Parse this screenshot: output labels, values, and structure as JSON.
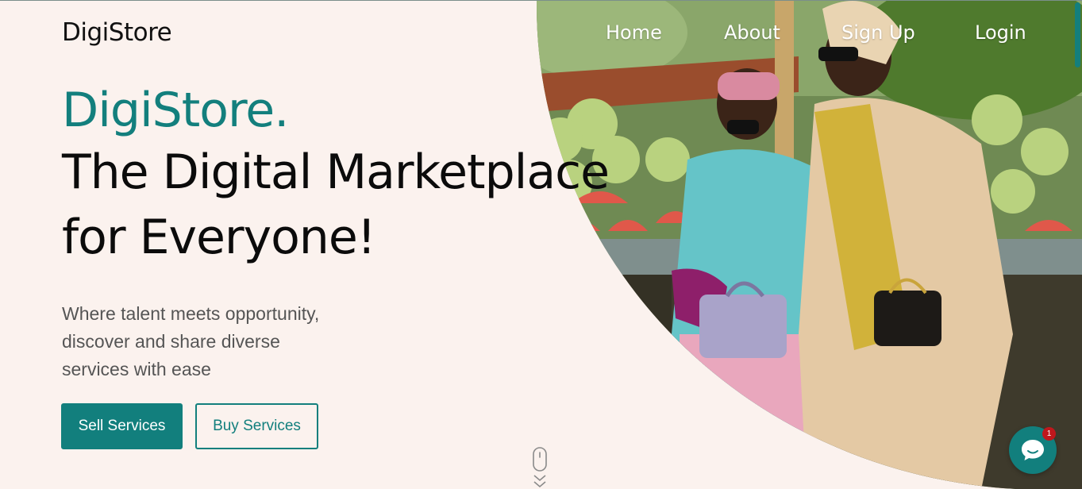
{
  "header": {
    "logo": "DigiStore",
    "nav": [
      {
        "label": "Home"
      },
      {
        "label": "About"
      },
      {
        "label": "Sign Up"
      },
      {
        "label": "Login"
      }
    ]
  },
  "hero": {
    "brand": "DigiStore.",
    "headline_line1": "The Digital Marketplace",
    "headline_line2": "for Everyone!",
    "tagline_lines": [
      "Where talent meets opportunity,",
      "discover and share diverse",
      "services with ease"
    ],
    "sell_button": "Sell Services",
    "buy_button": "Buy Services",
    "image_subject": "two-women-at-fruit-market-photo"
  },
  "chat": {
    "icon": "chat-bubble-icon",
    "badge_count": "1"
  },
  "colors": {
    "accent": "#127f7d",
    "background": "#fbf2ee",
    "badge": "#c0171c"
  }
}
